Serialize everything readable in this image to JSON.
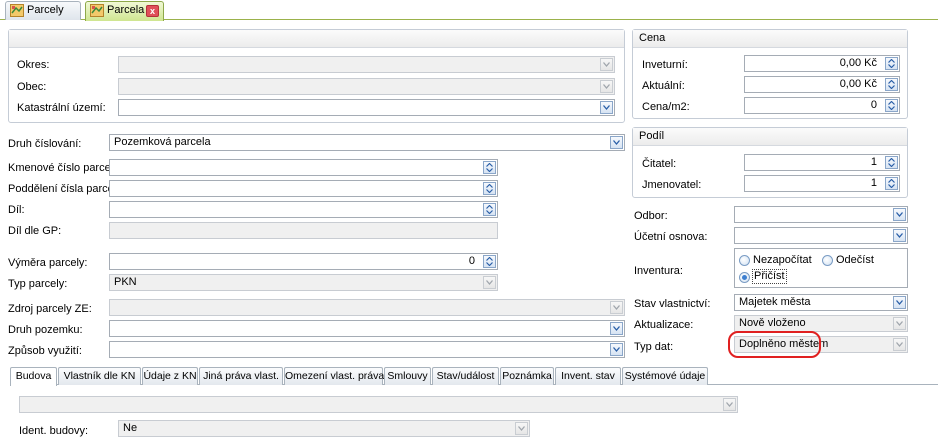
{
  "doc_tabs": [
    {
      "label": "Parcely"
    },
    {
      "label": "Parcela",
      "close": "x"
    }
  ],
  "location": {
    "okres_label": "Okres:",
    "okres_value": "",
    "obec_label": "Obec:",
    "obec_value": "",
    "ku_label": "Katastrální území:",
    "ku_value": ""
  },
  "parcel": {
    "druh_cislovani_label": "Druh číslování:",
    "druh_cislovani_value": "Pozemková parcela",
    "kmenove_label": "Kmenové číslo parcely:",
    "kmenove_value": "",
    "podd_label": "Poddělení čísla parcely:",
    "podd_value": "",
    "dil_label": "Díl:",
    "dil_value": "",
    "dil_gp_label": "Díl dle GP:",
    "dil_gp_value": "",
    "vymera_label": "Výměra parcely:",
    "vymera_value": "0",
    "typ_label": "Typ parcely:",
    "typ_value": "PKN",
    "zdroj_label": "Zdroj parcely ZE:",
    "zdroj_value": "",
    "druh_pozemku_label": "Druh pozemku:",
    "druh_pozemku_value": "",
    "zpusob_label": "Způsob využití:",
    "zpusob_value": ""
  },
  "cena": {
    "title": "Cena",
    "inventurni_label": "Inveturní:",
    "inventurni_value": "0,00 Kč",
    "aktualni_label": "Aktuální:",
    "aktualni_value": "0,00 Kč",
    "m2_label": "Cena/m2:",
    "m2_value": "0"
  },
  "podil": {
    "title": "Podíl",
    "citatel_label": "Čitatel:",
    "citatel_value": "1",
    "jmenovatel_label": "Jmenovatel:",
    "jmenovatel_value": "1"
  },
  "right": {
    "odbor_label": "Odbor:",
    "odbor_value": "",
    "osnova_label": "Účetní osnova:",
    "osnova_value": "",
    "inventura_label": "Inventura:",
    "inventura_options": [
      "Nezapočítat",
      "Odečíst",
      "Přičíst"
    ],
    "inventura_selected": "Přičíst",
    "stav_label": "Stav vlastnictví:",
    "stav_value": "Majetek města",
    "aktualizace_label": "Aktualizace:",
    "aktualizace_value": "Nově vloženo",
    "typ_dat_label": "Typ dat:",
    "typ_dat_value": "Doplněno městem"
  },
  "bottom_tabs": [
    "Budova",
    "Vlastník dle KN",
    "Údaje z KN",
    "Jiná práva vlast.",
    "Omezení vlast. práva",
    "Smlouvy",
    "Stav/událost",
    "Poznámka",
    "Invent. stav",
    "Systémové údaje"
  ],
  "budova": {
    "top_value": "",
    "ident_label": "Ident. budovy:",
    "ident_value": "Ne"
  },
  "colors": {
    "active_tab_green": "#cfe690",
    "highlight_red": "#e02020",
    "field_border": "#a5acb5"
  },
  "icons": {
    "combo": "chevron-down-icon",
    "spin": "spin-updown-icon",
    "tab": "parcel-map-icon",
    "close": "close-icon"
  }
}
